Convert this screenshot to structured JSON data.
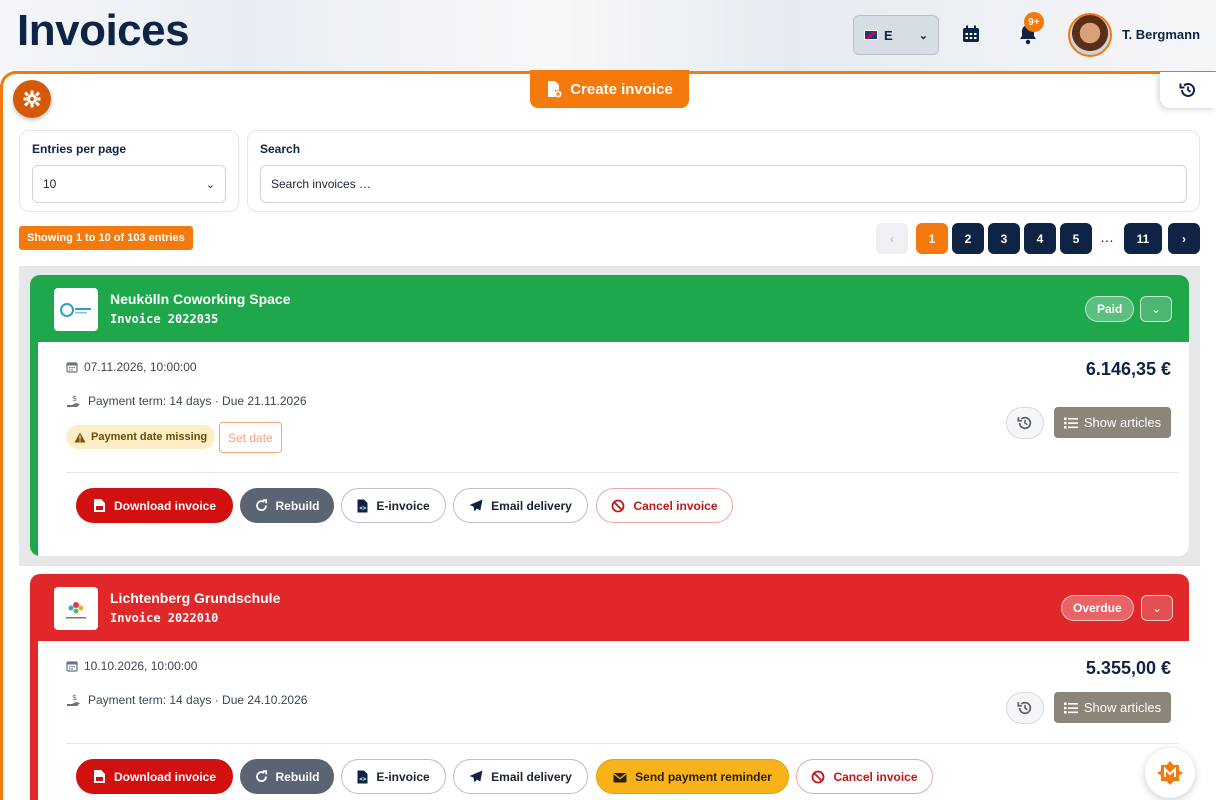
{
  "header": {
    "title": "Invoices",
    "language": {
      "selected": "E",
      "flag_icon": "uk-flag-icon"
    },
    "notifications_badge": "9+",
    "user_name": "T. Bergmann"
  },
  "toolbar": {
    "create_invoice_label": "Create invoice"
  },
  "filters": {
    "entries_label": "Entries per page",
    "entries_value": "10",
    "search_label": "Search",
    "search_placeholder": "Search invoices …"
  },
  "showing_text": "Showing 1 to 10 of 103 entries",
  "pagination": {
    "pages": [
      "1",
      "2",
      "3",
      "4",
      "5",
      "11"
    ],
    "active": "1",
    "ellipsis": "…"
  },
  "colors": {
    "accent": "#f47a0d",
    "paid": "#1ea84b",
    "overdue": "#e0282b",
    "navy": "#0f2344"
  },
  "invoices": [
    {
      "customer": "Neukölln Coworking Space",
      "number": "Invoice 2022035",
      "status": "Paid",
      "date": "07.11.2026, 10:00:00",
      "payment_term": "Payment term: 14 days · Due 21.11.2026",
      "amount": "6.146,35 €",
      "warning": "Payment date missing",
      "set_date_label": "Set date",
      "show_articles_label": "Show articles",
      "actions": {
        "download": "Download invoice",
        "rebuild": "Rebuild",
        "einvoice": "E-invoice",
        "email": "Email delivery",
        "cancel": "Cancel invoice"
      }
    },
    {
      "customer": "Lichtenberg Grundschule",
      "number": "Invoice 2022010",
      "status": "Overdue",
      "date": "10.10.2026, 10:00:00",
      "payment_term": "Payment term: 14 days · Due 24.10.2026",
      "amount": "5.355,00 €",
      "show_articles_label": "Show articles",
      "actions": {
        "download": "Download invoice",
        "rebuild": "Rebuild",
        "einvoice": "E-invoice",
        "email": "Email delivery",
        "reminder": "Send payment reminder",
        "cancel": "Cancel invoice"
      }
    }
  ]
}
